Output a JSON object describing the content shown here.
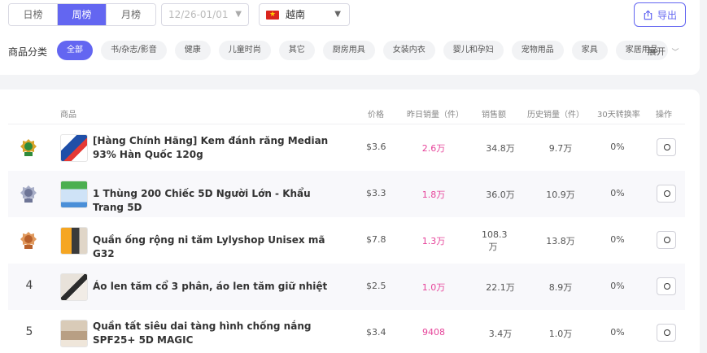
{
  "tabs": [
    {
      "label": "日榜",
      "active": false
    },
    {
      "label": "周榜",
      "active": true
    },
    {
      "label": "月榜",
      "active": false
    }
  ],
  "date_range": {
    "placeholder": "12/26-01/01"
  },
  "country": {
    "label": "越南",
    "flag": "vietnam-flag-icon"
  },
  "export": {
    "label": "导出",
    "icon": "export-icon"
  },
  "categories": {
    "label": "商品分类",
    "items": [
      "全部",
      "书/杂志/影音",
      "健康",
      "儿童时尚",
      "其它",
      "厨房用具",
      "女装内衣",
      "婴儿和孕妇",
      "宠物用品",
      "家具",
      "家居用品"
    ],
    "active_index": 0,
    "expand_label": "展开"
  },
  "table": {
    "headers": {
      "product": "商品",
      "price": "价格",
      "yesterday_sales": "昨日销量（件）",
      "revenue": "销售额",
      "history_sales": "历史销量（件）",
      "conversion": "30天转换率",
      "action": "操作"
    },
    "rows": [
      {
        "rank": "1",
        "medal": "gold-medal-icon",
        "name": "[Hàng Chính Hãng] Kem đánh răng Median 93% Hàn Quốc 120g",
        "price": "$3.6",
        "yesterday": "2.6万",
        "revenue": "34.8万",
        "history": "9.7万",
        "conversion": "0%"
      },
      {
        "rank": "2",
        "medal": "silver-medal-icon",
        "name": "1 Thùng 200 Chiếc 5D Người Lớn - Khẩu Trang 5D",
        "price": "$3.3",
        "yesterday": "1.8万",
        "revenue": "36.0万",
        "history": "10.9万",
        "conversion": "0%"
      },
      {
        "rank": "3",
        "medal": "bronze-medal-icon",
        "name": "Quần ống rộng ni tăm Lylyshop Unisex mã G32",
        "price": "$7.8",
        "yesterday": "1.3万",
        "revenue": "108.3万",
        "history": "13.8万",
        "conversion": "0%"
      },
      {
        "rank": "4",
        "medal": "",
        "name": "Áo len tăm cổ 3 phân, áo len tăm giữ nhiệt",
        "price": "$2.5",
        "yesterday": "1.0万",
        "revenue": "22.1万",
        "history": "8.9万",
        "conversion": "0%"
      },
      {
        "rank": "5",
        "medal": "",
        "name": "Quần tất siêu dai tàng hình chống nắng SPF25+ 5D MAGIC",
        "price": "$3.4",
        "yesterday": "9408",
        "revenue": "3.4万",
        "history": "1.0万",
        "conversion": "0%"
      }
    ]
  },
  "colors": {
    "accent": "#6366f1",
    "pink": "#e6449a"
  }
}
